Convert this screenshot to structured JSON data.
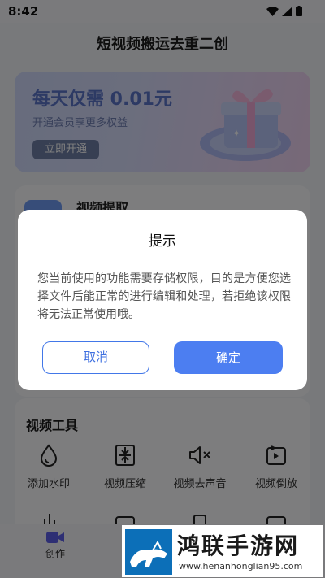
{
  "status_bar": {
    "time": "8:42"
  },
  "app": {
    "title": "短视频搬运去重二创"
  },
  "vip_banner": {
    "title": "每天仅需 0.01元",
    "subtitle": "开通会员享更多权益",
    "button": "立即开通"
  },
  "extract": {
    "label": "视频提取"
  },
  "tools": {
    "title": "视频工具",
    "items": [
      {
        "label": "添加水印",
        "icon": "droplet-icon"
      },
      {
        "label": "视频压缩",
        "icon": "compress-icon"
      },
      {
        "label": "视频去声音",
        "icon": "mute-icon"
      },
      {
        "label": "视频倒放",
        "icon": "reverse-icon"
      }
    ]
  },
  "bottom_nav": {
    "create_label": "创作"
  },
  "dialog": {
    "title": "提示",
    "message": "您当前使用的功能需要存储权限，目的是方便您选择文件后能正常的进行编辑和处理，若拒绝该权限将无法正常使用哦。",
    "cancel": "取消",
    "confirm": "确定"
  },
  "watermark": {
    "name": "鸿联手游网",
    "url": "www.henanhonglian95.com"
  },
  "colors": {
    "primary": "#4c7ef1",
    "vip_title": "#5b74c9",
    "overlay": "rgba(0,0,0,0.5)"
  }
}
